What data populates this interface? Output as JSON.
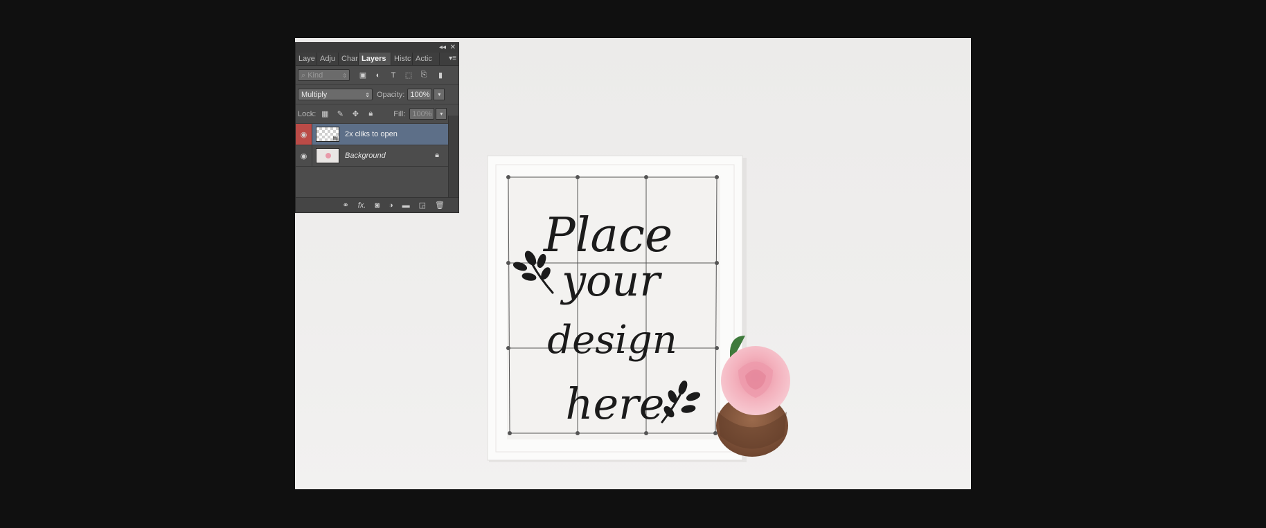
{
  "panel": {
    "title_controls": {
      "collapse": "◂◂",
      "close": "✕"
    },
    "tabs": [
      {
        "label": "Laye"
      },
      {
        "label": "Adju"
      },
      {
        "label": "Char"
      },
      {
        "label": "Layers"
      },
      {
        "label": "Histc"
      },
      {
        "label": "Actic"
      }
    ],
    "menu_icon": "panel-menu-icon",
    "filter": {
      "label": "Kind",
      "icons": [
        "image-filter-icon",
        "adjustment-filter-icon",
        "type-filter-icon",
        "shape-filter-icon",
        "smart-object-filter-icon"
      ]
    },
    "blend_mode": "Multiply",
    "opacity_label": "Opacity:",
    "opacity_value": "100%",
    "lock_label": "Lock:",
    "fill_label": "Fill:",
    "fill_value": "100%",
    "layers": [
      {
        "name": "2x cliks to open",
        "selected": true,
        "visible": true
      },
      {
        "name": "Background",
        "selected": false,
        "visible": true,
        "locked": true
      }
    ],
    "footer_icons": [
      "link-icon",
      "fx-icon",
      "mask-icon",
      "adjustment-icon",
      "group-icon",
      "new-layer-icon",
      "trash-icon"
    ]
  },
  "canvas": {
    "design_text": [
      "Place",
      "your",
      "design",
      "here"
    ],
    "colors": {
      "frame": "#fbfbfa",
      "grid": "#555555",
      "ink": "#1b1b1b",
      "rose": "#f2a9b5",
      "coconut": "#8a5a3e"
    }
  }
}
